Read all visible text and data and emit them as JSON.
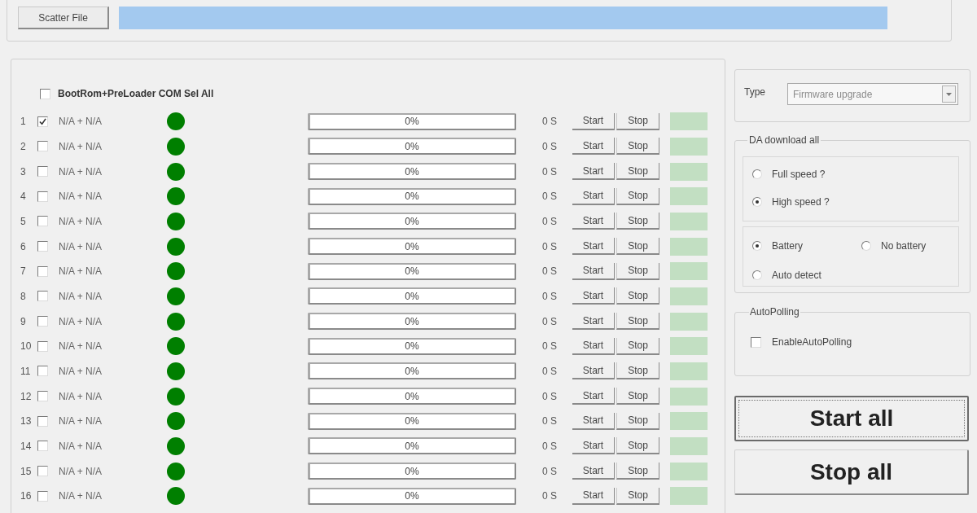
{
  "scatter": {
    "button": "Scatter File"
  },
  "ports": {
    "select_all": {
      "label": "BootRom+PreLoader COM Sel All",
      "checked": false
    },
    "rows": [
      {
        "number": "1",
        "checked": true,
        "device": "N/A + N/A",
        "color": "#007f00",
        "progress": "0%",
        "level": 0,
        "time": "0 S",
        "start": "Start",
        "stop": "Stop"
      },
      {
        "number": "2",
        "checked": false,
        "device": "N/A + N/A",
        "color": "#007f00",
        "progress": "0%",
        "level": 0,
        "time": "0 S",
        "start": "Start",
        "stop": "Stop"
      },
      {
        "number": "3",
        "checked": false,
        "device": "N/A + N/A",
        "color": "#007f00",
        "progress": "0%",
        "level": 0,
        "time": "0 S",
        "start": "Start",
        "stop": "Stop"
      },
      {
        "number": "4",
        "checked": false,
        "device": "N/A + N/A",
        "color": "#007f00",
        "progress": "0%",
        "level": 0,
        "time": "0 S",
        "start": "Start",
        "stop": "Stop"
      },
      {
        "number": "5",
        "checked": false,
        "device": "N/A + N/A",
        "color": "#007f00",
        "progress": "0%",
        "level": 0,
        "time": "0 S",
        "start": "Start",
        "stop": "Stop"
      },
      {
        "number": "6",
        "checked": false,
        "device": "N/A + N/A",
        "color": "#007f00",
        "progress": "0%",
        "level": 0,
        "time": "0 S",
        "start": "Start",
        "stop": "Stop"
      },
      {
        "number": "7",
        "checked": false,
        "device": "N/A + N/A",
        "color": "#007f00",
        "progress": "0%",
        "level": 0,
        "time": "0 S",
        "start": "Start",
        "stop": "Stop"
      },
      {
        "number": "8",
        "checked": false,
        "device": "N/A + N/A",
        "color": "#007f00",
        "progress": "0%",
        "level": 0,
        "time": "0 S",
        "start": "Start",
        "stop": "Stop"
      },
      {
        "number": "9",
        "checked": false,
        "device": "N/A + N/A",
        "color": "#007f00",
        "progress": "0%",
        "level": 0,
        "time": "0 S",
        "start": "Start",
        "stop": "Stop"
      },
      {
        "number": "10",
        "checked": false,
        "device": "N/A + N/A",
        "color": "#007f00",
        "progress": "0%",
        "level": 0,
        "time": "0 S",
        "start": "Start",
        "stop": "Stop"
      },
      {
        "number": "11",
        "checked": false,
        "device": "N/A + N/A",
        "color": "#007f00",
        "progress": "0%",
        "level": 0,
        "time": "0 S",
        "start": "Start",
        "stop": "Stop"
      },
      {
        "number": "12",
        "checked": false,
        "device": "N/A + N/A",
        "color": "#007f00",
        "progress": "0%",
        "level": 0,
        "time": "0 S",
        "start": "Start",
        "stop": "Stop"
      },
      {
        "number": "13",
        "checked": false,
        "device": "N/A + N/A",
        "color": "#007f00",
        "progress": "0%",
        "level": 0,
        "time": "0 S",
        "start": "Start",
        "stop": "Stop"
      },
      {
        "number": "14",
        "checked": false,
        "device": "N/A + N/A",
        "color": "#007f00",
        "progress": "0%",
        "level": 0,
        "time": "0 S",
        "start": "Start",
        "stop": "Stop"
      },
      {
        "number": "15",
        "checked": false,
        "device": "N/A + N/A",
        "color": "#007f00",
        "progress": "0%",
        "level": 0,
        "time": "0 S",
        "start": "Start",
        "stop": "Stop"
      },
      {
        "number": "16",
        "checked": false,
        "device": "N/A + N/A",
        "color": "#007f00",
        "progress": "0%",
        "level": 0,
        "time": "0 S",
        "start": "Start",
        "stop": "Stop"
      }
    ]
  },
  "type": {
    "label": "Type",
    "value": "Firmware upgrade",
    "disabled": true
  },
  "download": {
    "title": "DA download all",
    "speed_options": [
      {
        "label": "Full speed ?",
        "selected": false
      },
      {
        "label": "High speed ?",
        "selected": true
      }
    ],
    "battery_options": [
      {
        "label": "Battery",
        "selected": true
      },
      {
        "label": "No battery",
        "selected": false
      },
      {
        "label": "Auto detect",
        "selected": false
      }
    ]
  },
  "auto_polling": {
    "title": "AutoPolling",
    "option": {
      "label": "EnableAutoPolling",
      "checked": false
    }
  },
  "actions": [
    {
      "label": "Start all",
      "focused": true
    },
    {
      "label": "Stop all",
      "focused": false
    }
  ]
}
